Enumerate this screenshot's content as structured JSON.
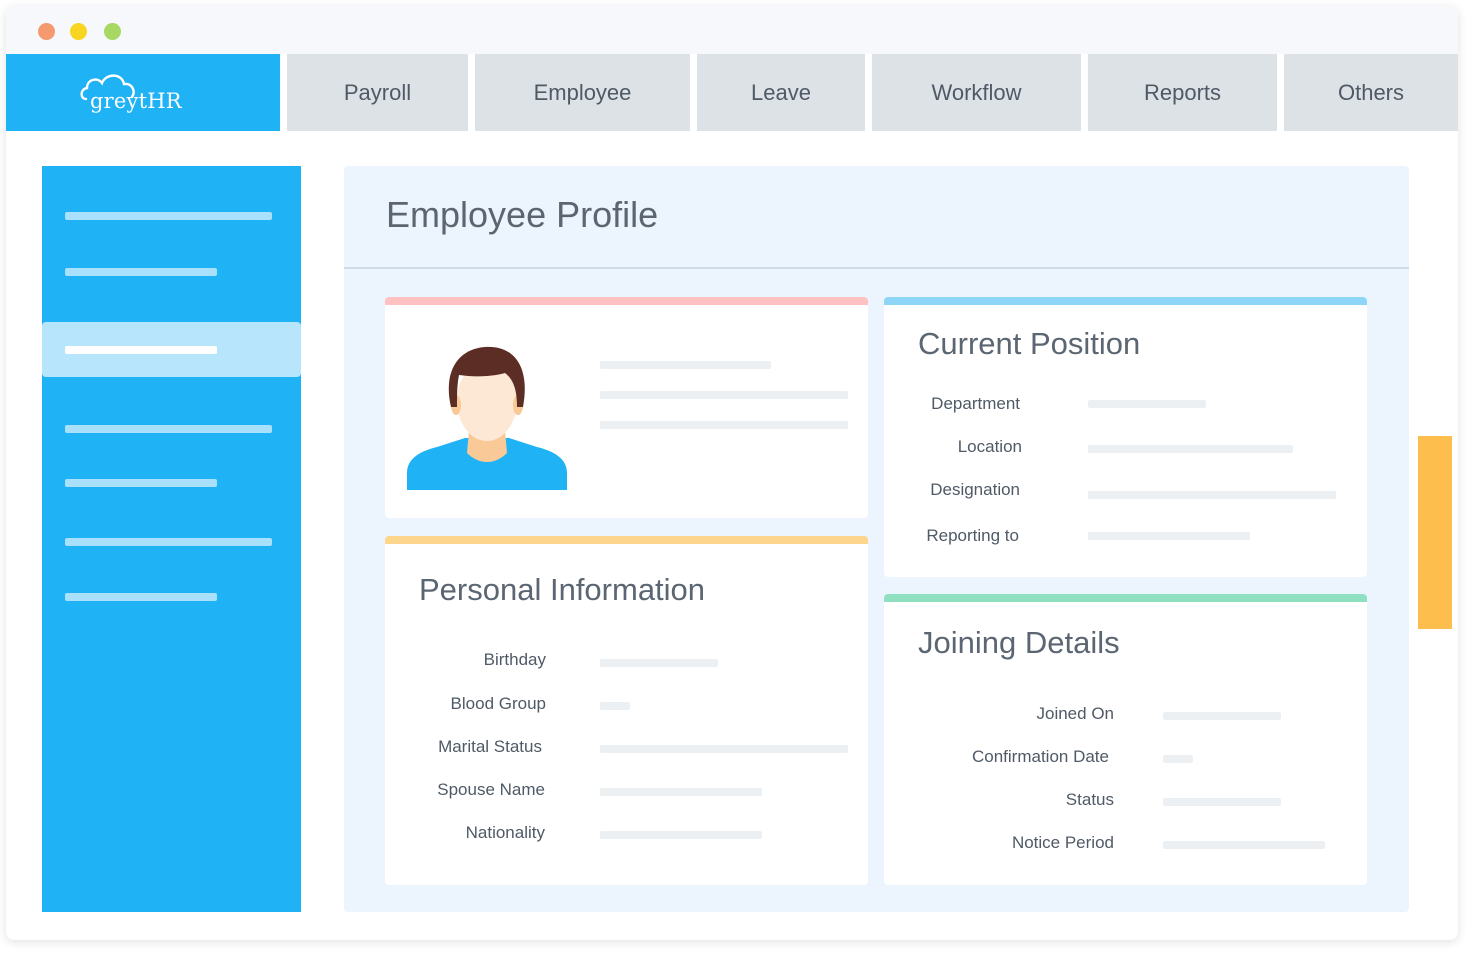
{
  "window": {
    "traffic_lights": [
      "close",
      "minimize",
      "maximize"
    ]
  },
  "brand": {
    "logo_text": "greytHR",
    "logo_icon": "cloud-icon",
    "color": "#1fb2f5"
  },
  "nav": {
    "items": [
      {
        "label": "Payroll"
      },
      {
        "label": "Employee"
      },
      {
        "label": "Leave"
      },
      {
        "label": "Workflow"
      },
      {
        "label": "Reports"
      },
      {
        "label": "Others"
      }
    ]
  },
  "page": {
    "title": "Employee Profile"
  },
  "profile_card": {
    "avatar_icon": "user-avatar-icon",
    "accent_color": "#ffc1c1"
  },
  "current_position": {
    "title": "Current Position",
    "accent_color": "#8ed6f8",
    "fields": [
      {
        "label": "Department"
      },
      {
        "label": "Location"
      },
      {
        "label": "Designation"
      },
      {
        "label": "Reporting to"
      }
    ]
  },
  "personal_information": {
    "title": "Personal Information",
    "accent_color": "#fdd58c",
    "fields": [
      {
        "label": "Birthday"
      },
      {
        "label": "Blood Group"
      },
      {
        "label": "Marital Status"
      },
      {
        "label": "Spouse Name"
      },
      {
        "label": "Nationality"
      }
    ]
  },
  "joining_details": {
    "title": "Joining Details",
    "accent_color": "#8ee0c1",
    "fields": [
      {
        "label": "Joined On"
      },
      {
        "label": "Confirmation Date"
      },
      {
        "label": "Status"
      },
      {
        "label": "Notice Period"
      }
    ]
  },
  "colors": {
    "sidebar": "#1fb2f5",
    "side_tab": "#fdbe4e",
    "content_bg": "#ecf5fd"
  }
}
